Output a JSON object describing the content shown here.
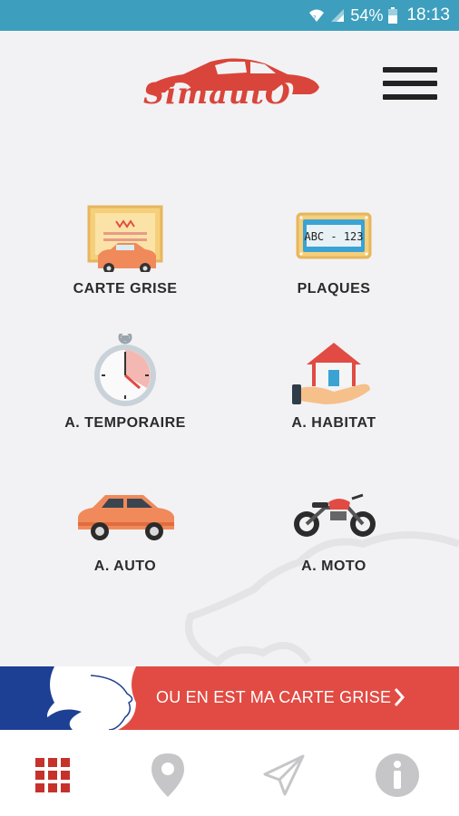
{
  "status_bar": {
    "battery_percent": "54%",
    "time": "18:13",
    "icons": [
      "wifi-icon",
      "signal-icon",
      "battery-icon"
    ]
  },
  "header": {
    "logo_text": "SimautO",
    "menu_icon": "hamburger-menu-icon"
  },
  "tiles": [
    {
      "label": "CARTE GRISE",
      "icon": "registration-certificate-icon"
    },
    {
      "label": "PLAQUES",
      "icon": "license-plate-icon",
      "plate_text": "ABC - 123"
    },
    {
      "label": "A. TEMPORAIRE",
      "icon": "stopwatch-icon"
    },
    {
      "label": "A. HABITAT",
      "icon": "house-in-hand-icon"
    },
    {
      "label": "A. AUTO",
      "icon": "car-icon"
    },
    {
      "label": "A. MOTO",
      "icon": "motorcycle-icon"
    }
  ],
  "banner": {
    "text": "OU EN EST MA CARTE GRISE",
    "icon": "chevron-right-icon"
  },
  "bottom_nav": {
    "items": [
      "grid-icon",
      "location-pin-icon",
      "send-icon",
      "info-icon"
    ],
    "active": "grid-icon"
  },
  "colors": {
    "status_bar": "#3d9fbd",
    "accent_red": "#e14b43",
    "flag_blue": "#1d3f94",
    "background": "#f2f2f4"
  }
}
